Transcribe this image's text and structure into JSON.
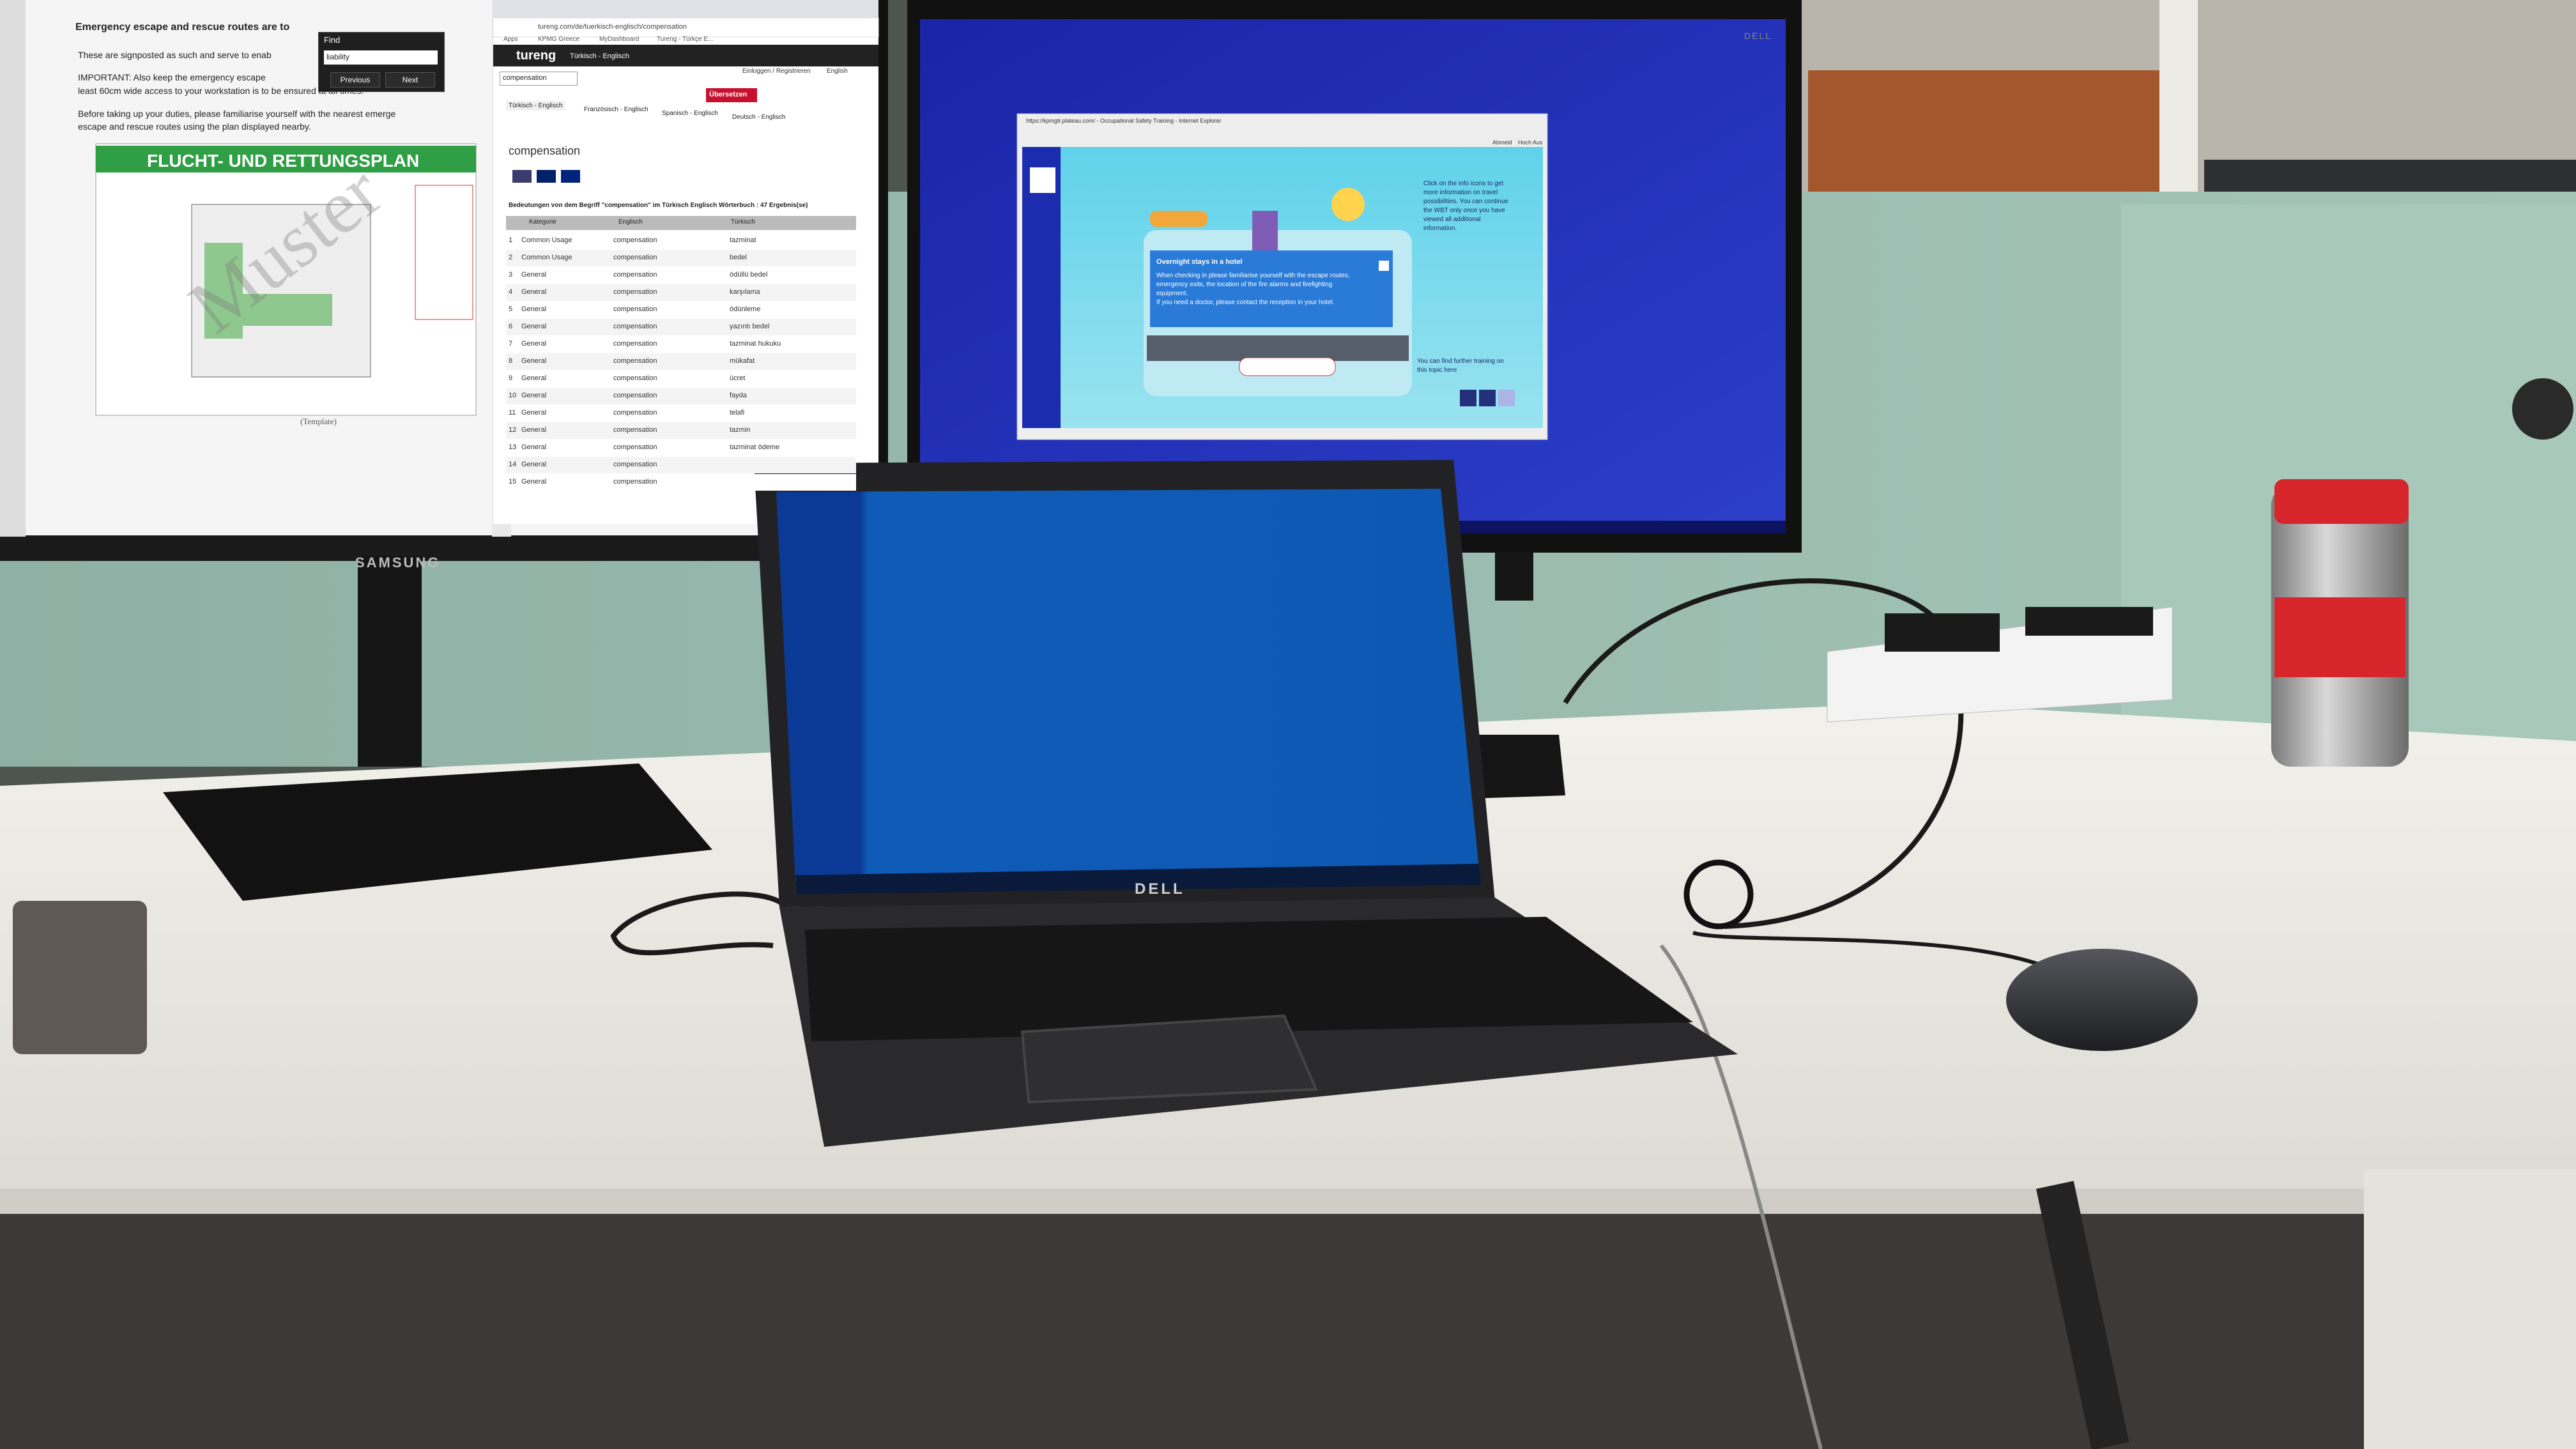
{
  "left_monitor": {
    "brand": "SAMSUNG",
    "document": {
      "lines": [
        "Emergency escape and rescue routes are to",
        "These are signposted as such and serve to enab",
        "IMPORTANT: Also keep the emergency escape",
        "least 60cm wide access to your workstation is to be ensured at all times.",
        "Before taking up your duties, please familiarise yourself with the nearest emerge",
        "escape and rescue routes using the plan displayed nearby."
      ],
      "plan_title": "FLUCHT- UND RETTUNGSPLAN",
      "watermark": "Muster",
      "caption": "(Template)"
    },
    "find_dialog": {
      "title": "Find",
      "value": "liability",
      "previous": "Previous",
      "next": "Next"
    },
    "browser": {
      "url": "tureng.com/de/tuerkisch-englisch/compensation",
      "bookmarks": [
        "Apps",
        "KPMG Greece",
        "MyDashboard",
        "Tureng - Türkçe E..."
      ],
      "site_name": "tureng",
      "lang_selector": "Türkisch - Englisch",
      "login": "Einloggen / Registrieren",
      "lang_button": "English",
      "search_value": "compensation",
      "translate_button": "Übersetzen",
      "tabs": [
        "Türkisch - Englisch",
        "Französisch - Englisch",
        "Spanisch - Englisch",
        "Deutsch - Englisch"
      ],
      "term": "compensation",
      "result_heading": "Bedeutungen von dem Begriff \"compensation\" im Türkisch Englisch Wörterbuch : 47 Ergebnis(se)",
      "table_headers": [
        "Kategorie",
        "Englisch",
        "Türkisch"
      ],
      "rows": [
        {
          "n": "1",
          "cat": "Common Usage",
          "en": "compensation",
          "tr": "tazminat"
        },
        {
          "n": "2",
          "cat": "Common Usage",
          "en": "compensation",
          "tr": "bedel"
        },
        {
          "n": "3",
          "cat": "General",
          "en": "compensation",
          "tr": "ödüllü bedel"
        },
        {
          "n": "4",
          "cat": "General",
          "en": "compensation",
          "tr": "karşılama"
        },
        {
          "n": "5",
          "cat": "General",
          "en": "compensation",
          "tr": "ödünleme"
        },
        {
          "n": "6",
          "cat": "General",
          "en": "compensation",
          "tr": "yazıntı bedel"
        },
        {
          "n": "7",
          "cat": "General",
          "en": "compensation",
          "tr": "tazminat hukuku"
        },
        {
          "n": "8",
          "cat": "General",
          "en": "compensation",
          "tr": "mükafat"
        },
        {
          "n": "9",
          "cat": "General",
          "en": "compensation",
          "tr": "ücret"
        },
        {
          "n": "10",
          "cat": "General",
          "en": "compensation",
          "tr": "fayda"
        },
        {
          "n": "11",
          "cat": "General",
          "en": "compensation",
          "tr": "telafi"
        },
        {
          "n": "12",
          "cat": "General",
          "en": "compensation",
          "tr": "tazmin"
        },
        {
          "n": "13",
          "cat": "General",
          "en": "compensation",
          "tr": "tazminat ödeme"
        },
        {
          "n": "14",
          "cat": "General",
          "en": "compensation",
          "tr": ""
        },
        {
          "n": "15",
          "cat": "General",
          "en": "compensation",
          "tr": ""
        }
      ]
    }
  },
  "right_monitor": {
    "brand": "DELL",
    "window_title": "https://kpmgtr.plateau.com/ - Occupational Safety Training - Internet Explorer",
    "lesson": {
      "popup_title": "Overnight stays in a hotel",
      "popup_text": [
        "When checking in please familiarise yourself with the escape routes,",
        "emergency exits, the location of the fire alarms and firefighting",
        "equipment.",
        "If you need a doctor, please contact the reception in your hotel."
      ],
      "side_text": [
        "Click on the info icons to get",
        "more information on travel",
        "possibilities. You can continue",
        "the WBT only once you have",
        "viewed all additional",
        "information."
      ],
      "side_text_bottom": [
        "You can find further training on",
        "this topic here"
      ],
      "links": [
        "Abmeld",
        "Hoch Aus"
      ]
    }
  },
  "laptop": {
    "brand": "DELL"
  },
  "colors": {
    "wall": "#91b3a6",
    "desk": "#ecebe6",
    "monitor_blue": "#1e2db5",
    "laptop_blue": "#1060b8",
    "plan_green": "#2f9e44",
    "cup_red": "#d6262c"
  }
}
